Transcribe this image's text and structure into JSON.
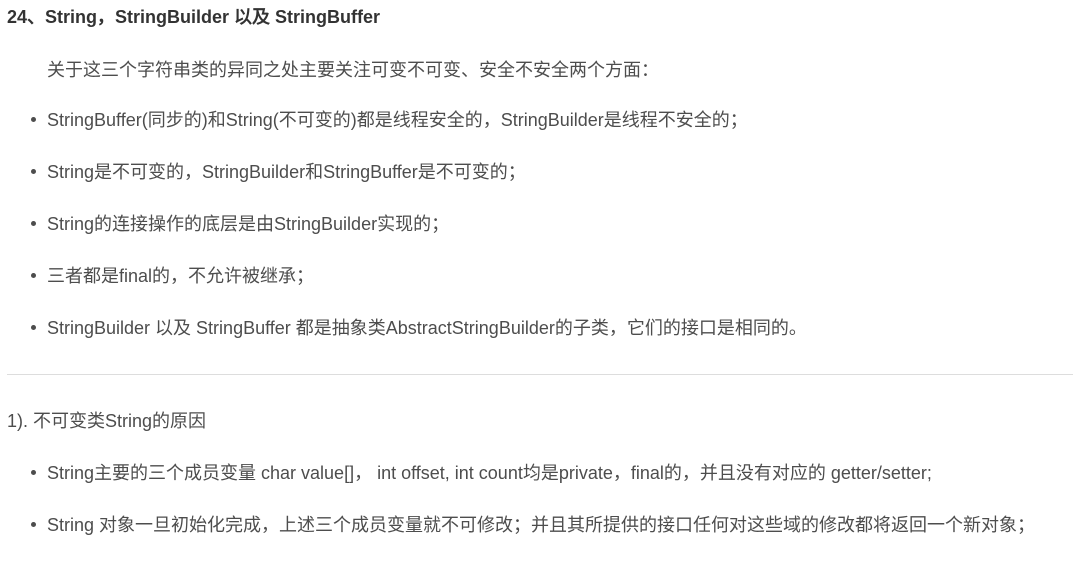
{
  "section_title": "24、String，StringBuilder 以及 StringBuffer",
  "intro": "关于这三个字符串类的异同之处主要关注可变不可变、安全不安全两个方面：",
  "bullets_1": [
    "StringBuffer(同步的)和String(不可变的)都是线程安全的，StringBuilder是线程不安全的；",
    "String是不可变的，StringBuilder和StringBuffer是不可变的；",
    "String的连接操作的底层是由StringBuilder实现的；",
    "三者都是final的，不允许被继承；",
    "StringBuilder 以及 StringBuffer 都是抽象类AbstractStringBuilder的子类，它们的接口是相同的。"
  ],
  "subsection_title": "1). 不可变类String的原因",
  "bullets_2": [
    "String主要的三个成员变量 char value[]， int offset, int count均是private，final的，并且没有对应的 getter/setter;",
    "String 对象一旦初始化完成，上述三个成员变量就不可修改；并且其所提供的接口任何对这些域的修改都将返回一个新对象；"
  ]
}
